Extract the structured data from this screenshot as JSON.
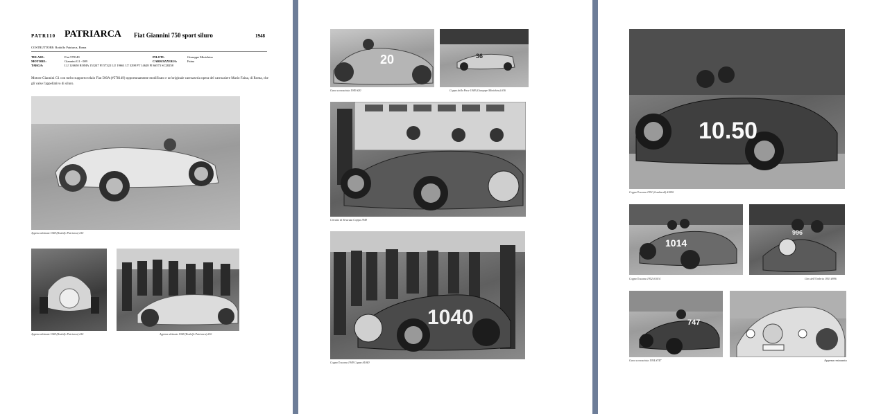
{
  "page1": {
    "code": "PATR110",
    "name": "PATRIARCA",
    "model": "Fiat Giannini 750 sport siluro",
    "year": "1948",
    "builder_label": "COSTRUTTORE: Rodolfo Patriarca, Roma",
    "specs_left": [
      {
        "label": "TELAIO:",
        "value": "Fiat 578149"
      },
      {
        "label": "MOTORE:",
        "value": "Giannini G1 - 009"
      },
      {
        "label": "TARGA:",
        "value": "LU 126650    ROMA 153247    FI 57322    LU 19661    LT 3298    PT 14628    FI 66573    SC28258"
      }
    ],
    "specs_right": [
      {
        "label": "PILOTI:",
        "value": "Giuseppe Minichino"
      },
      {
        "label": "CARROZZERIA:",
        "value": "Faina"
      }
    ],
    "description": "Motore Giannini G1 con turbo supporto telaio Fiat 500A (#578149) opportunamente modificato e un'originale carrozzeria opera del carrozziere Mario Faina, di Roma, che gli valse l'appellativo di siluro.",
    "captions": [
      "Appena ultimata 1948 (Rodolfo Patriarca) #10",
      "Appena ultimata 1948 (Rodolfo Patriarca) #10",
      "Appena ultimata 1948 (Rodolfo Patriarca) #10"
    ]
  },
  "page2": {
    "captions": [
      "Gara sconosciuta 1949 #20",
      "Coppa della Pace 1948 (Giuseppe Minichino) #36",
      "Circuito di Siracusa Coppa 1949",
      "Coppa Toscana 1949 Coppa #1040"
    ],
    "numbers": [
      "20",
      "36",
      "1040"
    ]
  },
  "page3": {
    "captions": [
      "Coppa Toscana 1951 (Lombardi) #1050",
      "Coppa Toscana 1952 #1014",
      "Giro dell'Umbria 1953 #996",
      "Gara sconosciuta 1954 #747",
      "Appena restaurata"
    ],
    "numbers": [
      "10.50",
      "1014",
      "747",
      "996"
    ]
  },
  "colors": {
    "background": "#6d7d98",
    "page": "#ffffff"
  }
}
